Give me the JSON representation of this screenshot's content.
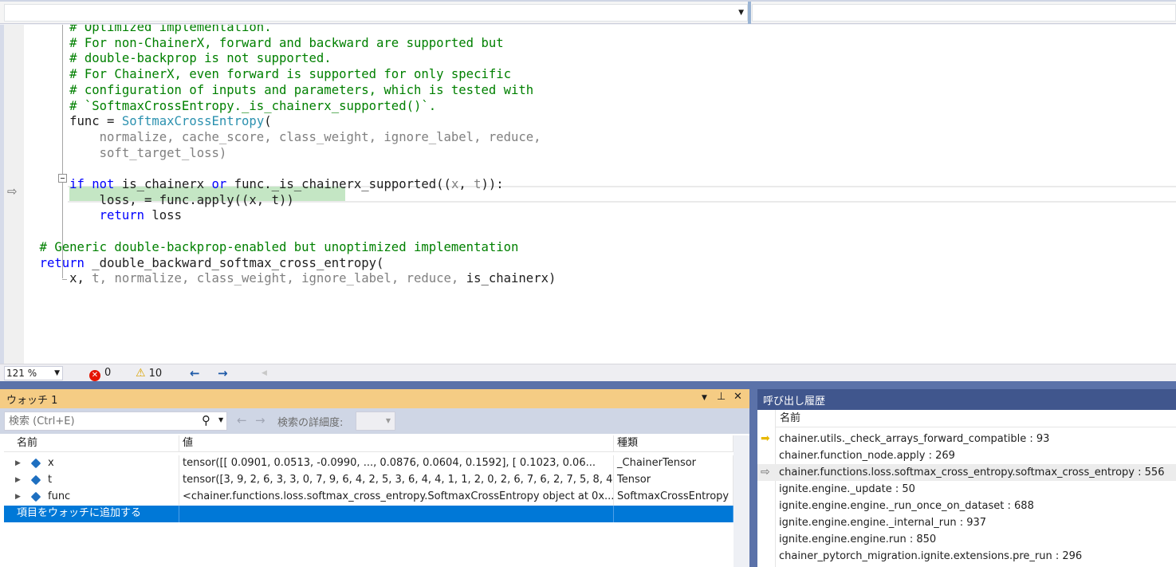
{
  "editor": {
    "lines": [
      {
        "segments": [
          {
            "t": "        # Optimized implementation.",
            "c": "cm"
          }
        ]
      },
      {
        "segments": [
          {
            "t": "        # For non-ChainerX, forward and backward are supported but",
            "c": "cm"
          }
        ]
      },
      {
        "segments": [
          {
            "t": "        # double-backprop is not supported.",
            "c": "cm"
          }
        ]
      },
      {
        "segments": [
          {
            "t": "        # For ChainerX, even forward is supported for only specific",
            "c": "cm"
          }
        ]
      },
      {
        "segments": [
          {
            "t": "        # configuration of inputs and parameters, which is tested with",
            "c": "cm"
          }
        ]
      },
      {
        "segments": [
          {
            "t": "        # `SoftmaxCrossEntropy._is_chainerx_supported()`.",
            "c": "cm"
          }
        ]
      },
      {
        "segments": [
          {
            "t": "        func = ",
            "c": ""
          },
          {
            "t": "SoftmaxCrossEntropy",
            "c": "ty"
          },
          {
            "t": "(",
            "c": ""
          }
        ]
      },
      {
        "segments": [
          {
            "t": "            normalize, cache_score, class_weight, ignore_label, reduce,",
            "c": "gr"
          }
        ]
      },
      {
        "segments": [
          {
            "t": "            soft_target_loss)",
            "c": "gr"
          }
        ]
      },
      {
        "segments": []
      },
      {
        "segments": [
          {
            "t": "        ",
            "c": ""
          },
          {
            "t": "if not",
            "c": "kw"
          },
          {
            "t": " is_chainerx ",
            "c": ""
          },
          {
            "t": "or",
            "c": "kw"
          },
          {
            "t": " func._is_chainerx_supported((",
            "c": ""
          },
          {
            "t": "x",
            "c": "gr"
          },
          {
            "t": ", ",
            "c": ""
          },
          {
            "t": "t",
            "c": "gr"
          },
          {
            "t": ")):",
            "c": ""
          }
        ]
      },
      {
        "segments": [
          {
            "t": "            loss, = func.apply((x, t))",
            "c": ""
          }
        ]
      },
      {
        "segments": [
          {
            "t": "            ",
            "c": ""
          },
          {
            "t": "return",
            "c": "kw"
          },
          {
            "t": " loss",
            "c": ""
          }
        ]
      },
      {
        "segments": []
      },
      {
        "segments": [
          {
            "t": "    # Generic double-backprop-enabled but unoptimized implementation",
            "c": "cm"
          }
        ]
      },
      {
        "segments": [
          {
            "t": "    ",
            "c": ""
          },
          {
            "t": "return",
            "c": "kw"
          },
          {
            "t": " _double_backward_softmax_cross_entropy(",
            "c": ""
          }
        ]
      },
      {
        "segments": [
          {
            "t": "        x, ",
            "c": ""
          },
          {
            "t": "t",
            "c": "gr"
          },
          {
            "t": ", normalize, class_weight, ignore_label, reduce, ",
            "c": "gr"
          },
          {
            "t": "is_chainerx)",
            "c": ""
          }
        ]
      }
    ]
  },
  "statusbar": {
    "zoom": "121 %",
    "errors": "0",
    "warnings": "10"
  },
  "watch": {
    "title": "ウォッチ 1",
    "search_placeholder": "検索 (Ctrl+E)",
    "search_depth_label": "検索の詳細度:",
    "columns": {
      "name": "名前",
      "value": "値",
      "type": "種類"
    },
    "rows": [
      {
        "name": "x",
        "value": "tensor([[ 0.0901,  0.0513, -0.0990,  ...,  0.0876,  0.0604,  0.1592],        [ 0.1023,  0.06...",
        "type": "_ChainerTensor"
      },
      {
        "name": "t",
        "value": "tensor([3, 9, 2, 6, 3, 3, 0, 7, 9, 6, 4, 2, 5, 3, 6, 4, 4, 1, 1, 2, 0, 2, 6, 7,        6, 2, 7, 5, 8, 4, ...",
        "type": "Tensor"
      },
      {
        "name": "func",
        "value": "<chainer.functions.loss.softmax_cross_entropy.SoftmaxCrossEntropy object at 0x...",
        "type": "SoftmaxCrossEntropy"
      }
    ],
    "add_item": "項目をウォッチに追加する"
  },
  "callstack": {
    "title": "呼び出し履歴",
    "column_name": "名前",
    "frames": [
      {
        "text": "chainer.utils._check_arrays_forward_compatible : 93",
        "icon": "current-statement-arrow-icon"
      },
      {
        "text": "chainer.function_node.apply : 269",
        "icon": ""
      },
      {
        "text": "chainer.functions.loss.softmax_cross_entropy.softmax_cross_entropy : 556",
        "icon": "return-point-arrow-icon"
      },
      {
        "text": "ignite.engine._update : 50",
        "icon": ""
      },
      {
        "text": "ignite.engine.engine._run_once_on_dataset : 688",
        "icon": ""
      },
      {
        "text": "ignite.engine.engine._internal_run : 937",
        "icon": ""
      },
      {
        "text": "ignite.engine.engine.run : 850",
        "icon": ""
      },
      {
        "text": "chainer_pytorch_migration.ignite.extensions.pre_run : 296",
        "icon": ""
      }
    ]
  },
  "colors": {
    "accent": "#0078d7",
    "watch_title": "#f5cc84",
    "callstack_title": "#40568d",
    "current_line_highlight": "#c4e6c4"
  }
}
